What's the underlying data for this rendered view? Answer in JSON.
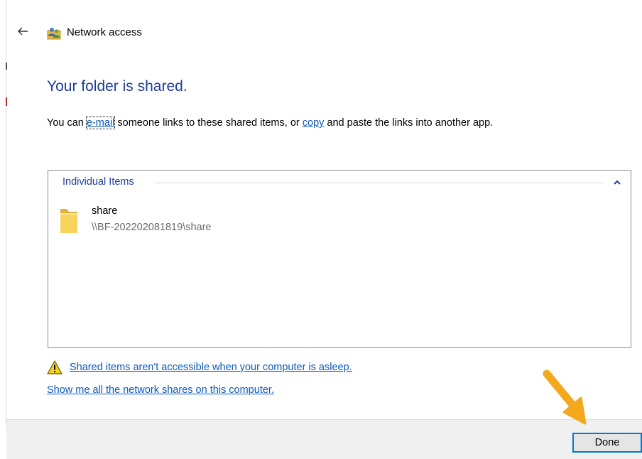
{
  "window": {
    "title": "Network access",
    "back_icon": "back-arrow-icon",
    "title_icon": "network-users-icon"
  },
  "main": {
    "heading": "Your folder is shared.",
    "description": {
      "before": "You can ",
      "email_link": "e-mail",
      "middle": " someone links to these shared items, or ",
      "copy_link": "copy",
      "after": " and paste the links into another app."
    }
  },
  "items_panel": {
    "group_header": "Individual Items",
    "collapse_icon": "chevron-up-icon",
    "items": [
      {
        "name": "share",
        "path": "\\\\BF-202202081819\\share",
        "icon": "folder-icon"
      }
    ]
  },
  "links": {
    "warning_icon": "warning-icon",
    "sleep_warning": "Shared items aren't accessible when your computer is asleep.",
    "show_shares": "Show me all the network shares on this computer."
  },
  "footer": {
    "done_label": "Done"
  },
  "colors": {
    "heading": "#1f3d99",
    "link": "#0b58b8",
    "footer_bg": "#f0f0f0",
    "button_border": "#0078d7",
    "annotation_arrow": "#f4a81c"
  }
}
